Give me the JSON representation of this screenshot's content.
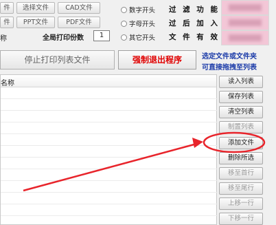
{
  "top_buttons": [
    {
      "name": "btn-frag-top",
      "label": "件"
    },
    {
      "name": "btn-select-file",
      "label": "选择文件"
    },
    {
      "name": "btn-cad-file",
      "label": "CAD文件"
    },
    {
      "name": "btn-frag-mid",
      "label": "件"
    },
    {
      "name": "btn-ppt-file",
      "label": "PPT文件"
    },
    {
      "name": "btn-pdf-file",
      "label": "PDF文件"
    }
  ],
  "label_frag": "称",
  "print_copies": {
    "label": "全局打印份数",
    "value": "1"
  },
  "stop_button": "停止打印列表文件",
  "force_exit_button": "强制退出程序",
  "radios": [
    "数字开头",
    "字母开头",
    "其它开头"
  ],
  "filter_labels": [
    "过 滤 功 能",
    "过 后 加 入",
    "文 件 有 效"
  ],
  "hint": [
    "选定文件或文件夹",
    "可直接拖拽至列表"
  ],
  "list_header": "名称",
  "side_buttons": [
    {
      "name": "btn-read-list",
      "label": "读入列表",
      "enabled": true
    },
    {
      "name": "btn-save-list",
      "label": "保存列表",
      "enabled": true
    },
    {
      "name": "btn-clear-list",
      "label": "清空列表",
      "enabled": true
    },
    {
      "name": "btn-reset-list",
      "label": "制置列表",
      "enabled": false
    },
    {
      "name": "btn-add-file",
      "label": "添加文件",
      "enabled": true
    },
    {
      "name": "btn-delete-selected",
      "label": "删除所选",
      "enabled": true
    },
    {
      "name": "btn-move-first",
      "label": "移至首行",
      "enabled": false
    },
    {
      "name": "btn-move-last",
      "label": "移至尾行",
      "enabled": false
    },
    {
      "name": "btn-move-up",
      "label": "上移一行",
      "enabled": false
    },
    {
      "name": "btn-move-down",
      "label": "下移一行",
      "enabled": false
    }
  ],
  "colors": {
    "exit_text": "#e00000",
    "hint_text": "#1a3aa8",
    "annotation": "#e8242b"
  }
}
